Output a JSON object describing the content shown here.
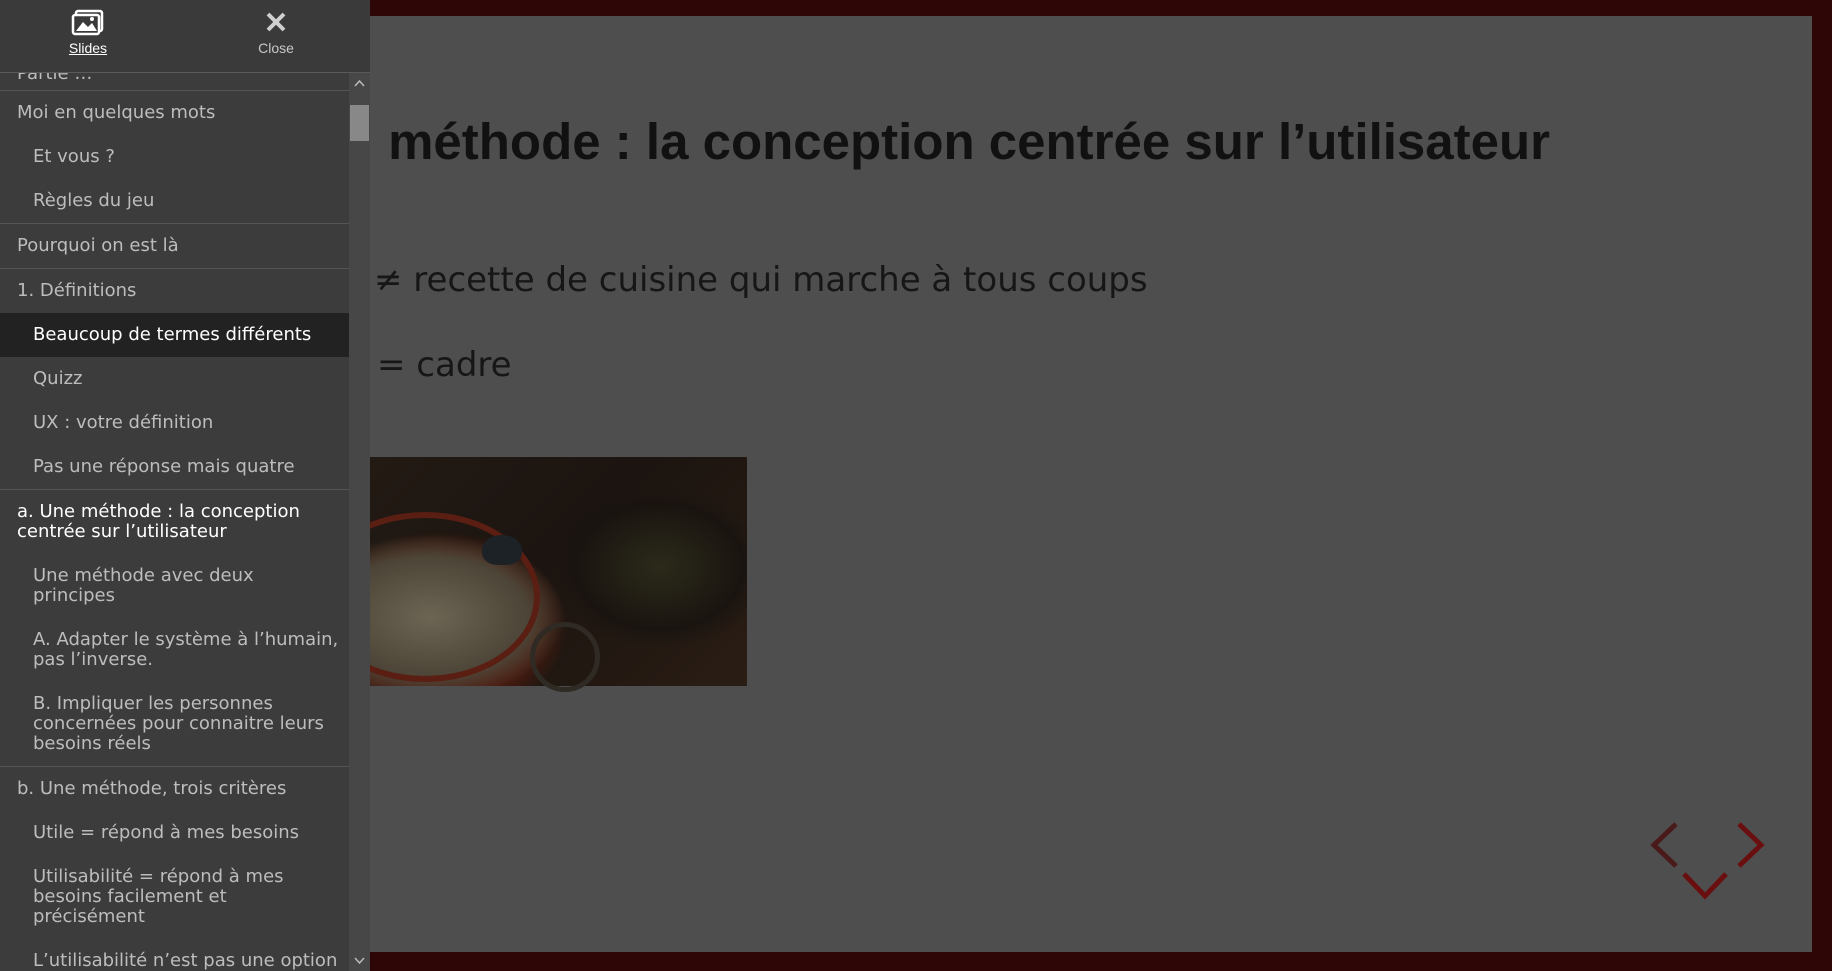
{
  "sidebar": {
    "header": {
      "slides_label": "Slides",
      "close_label": "Close"
    },
    "items": [
      {
        "label": "Partie …",
        "level": "sec",
        "state": "cut"
      },
      {
        "label": "Moi en quelques mots",
        "level": "sec"
      },
      {
        "label": "Et vous ?",
        "level": "sub"
      },
      {
        "label": "Règles du jeu",
        "level": "sub"
      },
      {
        "label": "Pourquoi on est là",
        "level": "sec"
      },
      {
        "label": "1. Définitions",
        "level": "sec"
      },
      {
        "label": "Beaucoup de termes différents",
        "level": "sub",
        "state": "active"
      },
      {
        "label": "Quizz",
        "level": "sub"
      },
      {
        "label": "UX : votre définition",
        "level": "sub"
      },
      {
        "label": "Pas une réponse mais quatre",
        "level": "sub"
      },
      {
        "label": "a. Une méthode : la conception centrée sur l’utilisateur",
        "level": "sec",
        "state": "current"
      },
      {
        "label": "Une méthode avec deux principes",
        "level": "sub"
      },
      {
        "label": "A. Adapter le système à l’humain, pas l’inverse.",
        "level": "sub"
      },
      {
        "label": "B. Impliquer les personnes concernées pour connaitre leurs besoins réels",
        "level": "sub"
      },
      {
        "label": "b. Une méthode, trois critères",
        "level": "sec"
      },
      {
        "label": "Utile = répond à mes besoins",
        "level": "sub"
      },
      {
        "label": "Utilisabilité = répond à mes besoins facilement et précisément",
        "level": "sub"
      },
      {
        "label": "L’utilisabilité n’est pas une option",
        "level": "sub"
      }
    ]
  },
  "slide": {
    "title": "méthode : la conception centrée sur l’utilisateur",
    "bullet1": "≠ recette de cuisine qui marche à tous coups",
    "bullet2": "= cadre"
  },
  "colors": {
    "frame": "#2e0606",
    "slide_bg": "#4e4e4e",
    "sidebar_bg": "#3c3c3c",
    "active_item_bg": "#222222",
    "arrow": "#6a0f0f"
  }
}
